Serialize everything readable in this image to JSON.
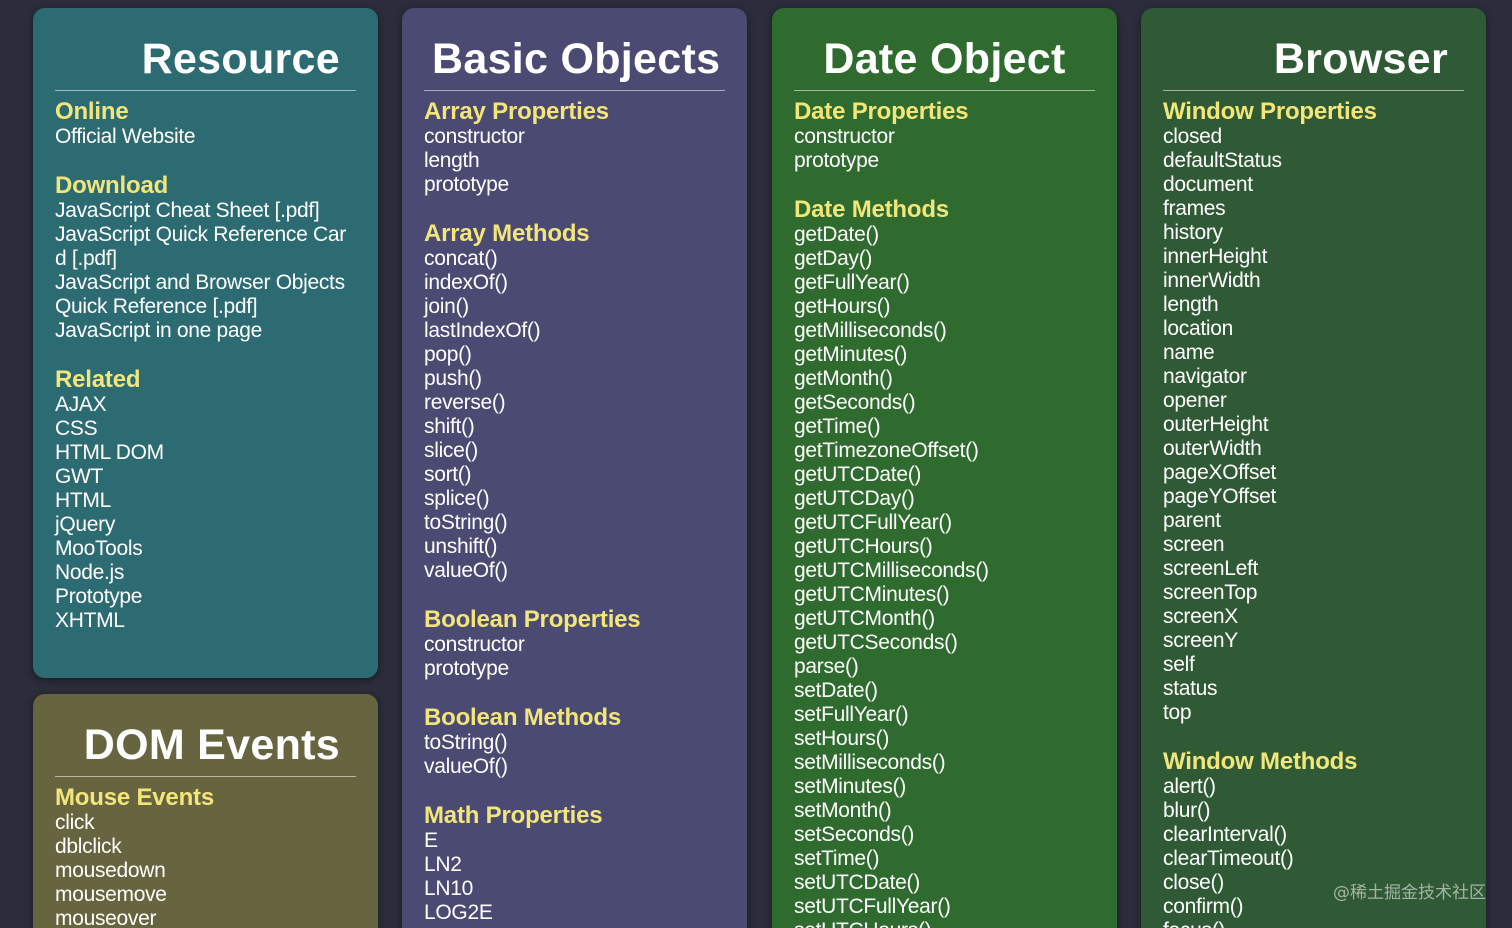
{
  "colors": {
    "background": "#2b2d3b",
    "resource_card": "#2d6b73",
    "dom_card": "#67653f",
    "basic_card": "#4a4a72",
    "date_card": "#2f6a2e",
    "browser_card": "#2f5a35",
    "section_heading": "#f2e67a",
    "item_text": "#ffffff"
  },
  "resource": {
    "title": "Resource",
    "online": {
      "heading": "Online",
      "items": [
        "Official Website"
      ]
    },
    "download": {
      "heading": "Download",
      "items": [
        "JavaScript Cheat Sheet [.pdf]",
        "JavaScript Quick Reference Card [.pdf]",
        "JavaScript and Browser Objects Quick Reference [.pdf]",
        "JavaScript in one page"
      ]
    },
    "related": {
      "heading": "Related",
      "items": [
        "AJAX",
        "CSS",
        "HTML DOM",
        "GWT",
        "HTML",
        "jQuery",
        "MooTools",
        "Node.js",
        "Prototype",
        "XHTML"
      ]
    }
  },
  "dom_events": {
    "title": "DOM Events",
    "mouse": {
      "heading": "Mouse Events",
      "items": [
        "click",
        "dblclick",
        "mousedown",
        "mousemove",
        "mouseover"
      ]
    }
  },
  "basic": {
    "title": "Basic Objects",
    "array_props": {
      "heading": "Array Properties",
      "items": [
        "constructor",
        "length",
        "prototype"
      ]
    },
    "array_methods": {
      "heading": "Array Methods",
      "items": [
        "concat()",
        "indexOf()",
        "join()",
        "lastIndexOf()",
        "pop()",
        "push()",
        "reverse()",
        "shift()",
        "slice()",
        "sort()",
        "splice()",
        "toString()",
        "unshift()",
        "valueOf()"
      ]
    },
    "boolean_props": {
      "heading": "Boolean Properties",
      "items": [
        "constructor",
        "prototype"
      ]
    },
    "boolean_methods": {
      "heading": "Boolean Methods",
      "items": [
        "toString()",
        "valueOf()"
      ]
    },
    "math_props": {
      "heading": "Math Properties",
      "items": [
        "E",
        "LN2",
        "LN10",
        "LOG2E"
      ]
    }
  },
  "date": {
    "title": "Date Object",
    "props": {
      "heading": "Date Properties",
      "items": [
        "constructor",
        "prototype"
      ]
    },
    "methods": {
      "heading": "Date Methods",
      "items": [
        "getDate()",
        "getDay()",
        "getFullYear()",
        "getHours()",
        "getMilliseconds()",
        "getMinutes()",
        "getMonth()",
        "getSeconds()",
        "getTime()",
        "getTimezoneOffset()",
        "getUTCDate()",
        "getUTCDay()",
        "getUTCFullYear()",
        "getUTCHours()",
        "getUTCMilliseconds()",
        "getUTCMinutes()",
        "getUTCMonth()",
        "getUTCSeconds()",
        "parse()",
        "setDate()",
        "setFullYear()",
        "setHours()",
        "setMilliseconds()",
        "setMinutes()",
        "setMonth()",
        "setSeconds()",
        "setTime()",
        "setUTCDate()",
        "setUTCFullYear()",
        "setUTCHours()"
      ]
    }
  },
  "browser": {
    "title": "Browser",
    "window_props": {
      "heading": "Window Properties",
      "items": [
        "closed",
        "defaultStatus",
        "document",
        "frames",
        "history",
        "innerHeight",
        "innerWidth",
        "length",
        "location",
        "name",
        "navigator",
        "opener",
        "outerHeight",
        "outerWidth",
        "pageXOffset",
        "pageYOffset",
        "parent",
        "screen",
        "screenLeft",
        "screenTop",
        "screenX",
        "screenY",
        "self",
        "status",
        "top"
      ]
    },
    "window_methods": {
      "heading": "Window Methods",
      "items": [
        "alert()",
        "blur()",
        "clearInterval()",
        "clearTimeout()",
        "close()",
        "confirm()",
        "focus()"
      ]
    }
  },
  "watermark": "@稀土掘金技术社区"
}
